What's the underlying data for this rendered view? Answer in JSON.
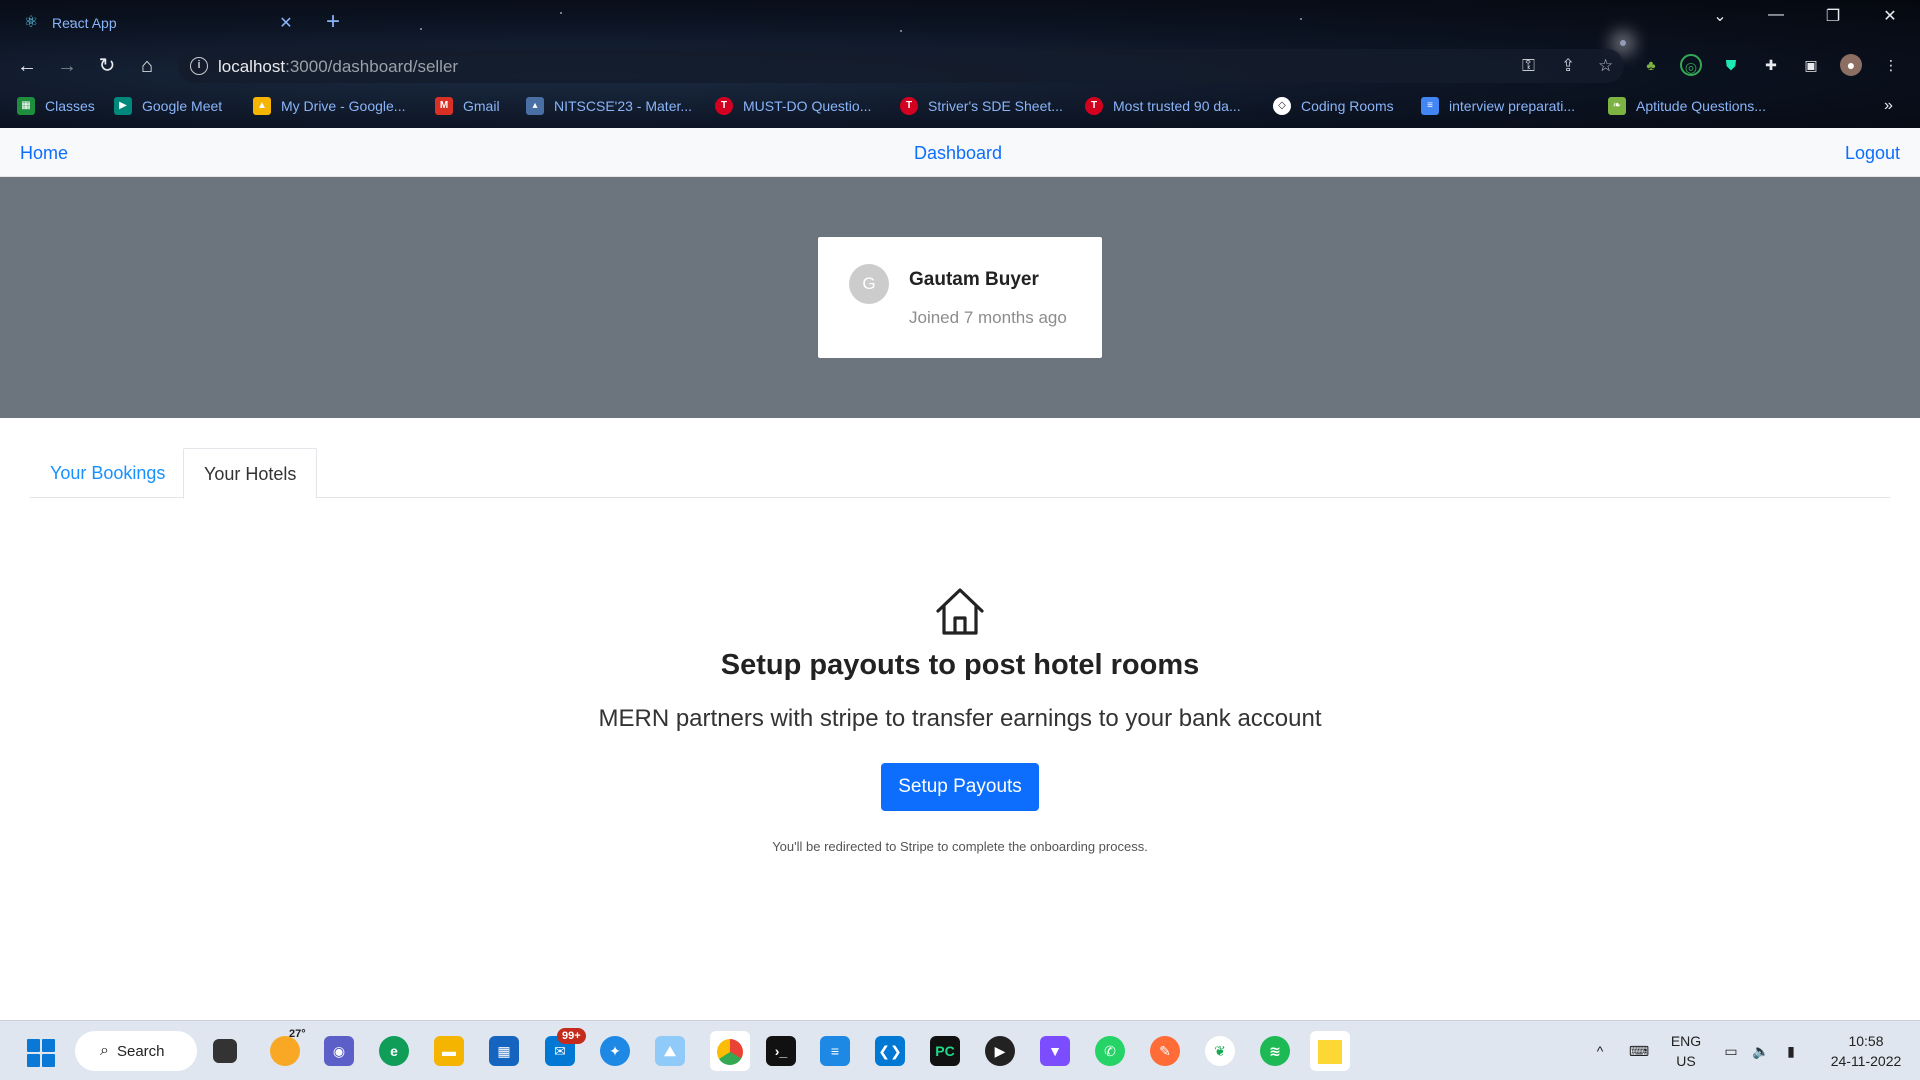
{
  "browser": {
    "tab_title": "React App",
    "url_host": "localhost",
    "url_rest": ":3000/dashboard/seller",
    "bookmarks": [
      {
        "label": "Classes",
        "icon": "classroom-icon",
        "color": "#1e8e3e"
      },
      {
        "label": "Google Meet",
        "icon": "meet-icon",
        "color": "#00897b"
      },
      {
        "label": "My Drive - Google...",
        "icon": "drive-icon",
        "color": "#f4b400"
      },
      {
        "label": "Gmail",
        "icon": "gmail-icon",
        "color": "#d93025"
      },
      {
        "label": "NITSCSE'23 - Mater...",
        "icon": "graduation-icon",
        "color": "#4a6fa5"
      },
      {
        "label": "MUST-DO Questio...",
        "icon": "tuf-icon",
        "color": "#d3001f"
      },
      {
        "label": "Striver's SDE Sheet...",
        "icon": "tuf-icon",
        "color": "#d3001f"
      },
      {
        "label": "Most trusted 90 da...",
        "icon": "tuf-icon",
        "color": "#d3001f"
      },
      {
        "label": "Coding Rooms",
        "icon": "coding-rooms-icon",
        "color": "#ffffff"
      },
      {
        "label": "interview preparati...",
        "icon": "docs-icon",
        "color": "#4285f4"
      },
      {
        "label": "Aptitude Questions...",
        "icon": "leaf-icon",
        "color": "#7cb342"
      }
    ]
  },
  "nav": {
    "home": "Home",
    "dashboard": "Dashboard",
    "logout": "Logout"
  },
  "profile": {
    "initial": "G",
    "name": "Gautam Buyer",
    "joined": "Joined 7 months ago"
  },
  "tabs": {
    "bookings": "Your Bookings",
    "hotels": "Your Hotels",
    "active": "hotels"
  },
  "empty_state": {
    "icon": "home-icon",
    "title": "Setup payouts to post hotel rooms",
    "lead": "MERN partners with stripe to transfer earnings to your bank account",
    "button": "Setup Payouts",
    "note": "You'll be redirected to Stripe to complete the onboarding process."
  },
  "taskbar": {
    "search": "Search",
    "weather": "27°",
    "mail_badge": "99+",
    "lang_top": "ENG",
    "lang_bottom": "US",
    "time": "10:58",
    "date": "24-11-2022"
  },
  "colors": {
    "primary": "#0d6efd",
    "hero_bg": "#6c757d",
    "tab_link": "#1890ff"
  }
}
